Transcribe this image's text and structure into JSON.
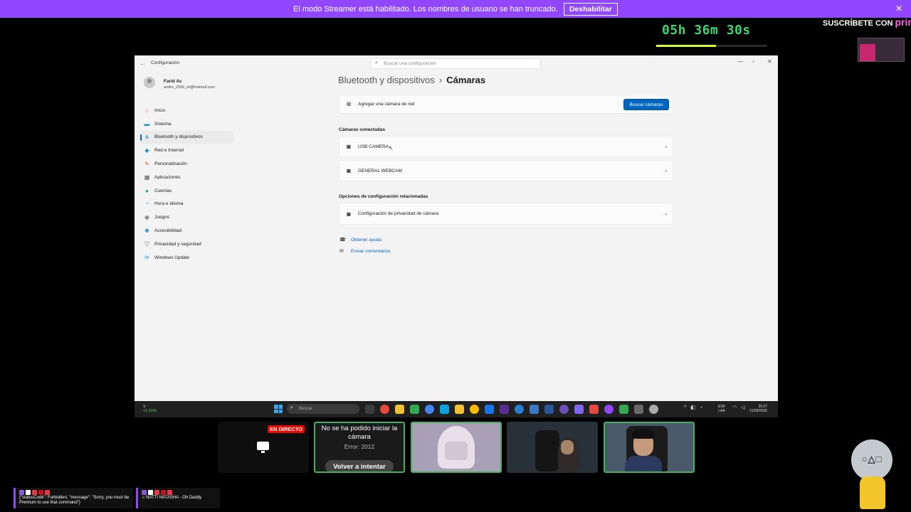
{
  "banner": {
    "text": "El modo Streamer está habilitado. Los nombres de usuario se han truncado.",
    "button": "Deshabilitar",
    "close": "✕"
  },
  "timer": {
    "text": "05h 36m 30s",
    "progress": 0.54
  },
  "prime": {
    "prefix": "SUSCRÍBETE CON",
    "brand": "prime"
  },
  "settings": {
    "app_title": "Configuración",
    "search_placeholder": "Buscar una configuración",
    "user": {
      "name": "Farid Ac",
      "email": "andre_2006_el@hotmail.com"
    },
    "nav": [
      {
        "label": "Inicio",
        "icon": "home-icon",
        "glyph": "⌂",
        "color": "#d9822b"
      },
      {
        "label": "Sistema",
        "icon": "system-icon",
        "glyph": "▬",
        "color": "#1b8fd6"
      },
      {
        "label": "Bluetooth y dispositivos",
        "icon": "bluetooth-icon",
        "glyph": "ʙ",
        "color": "#1b8fd6",
        "active": true
      },
      {
        "label": "Red e Internet",
        "icon": "network-icon",
        "glyph": "◆",
        "color": "#1b8fd6"
      },
      {
        "label": "Personalización",
        "icon": "brush-icon",
        "glyph": "✎",
        "color": "#c25b28"
      },
      {
        "label": "Aplicaciones",
        "icon": "apps-icon",
        "glyph": "▦",
        "color": "#555555"
      },
      {
        "label": "Cuentas",
        "icon": "accounts-icon",
        "glyph": "●",
        "color": "#2aa36b"
      },
      {
        "label": "Hora e idioma",
        "icon": "clock-globe-icon",
        "glyph": "◔",
        "color": "#1b8fd6"
      },
      {
        "label": "Juegos",
        "icon": "gamepad-icon",
        "glyph": "◉",
        "color": "#777777"
      },
      {
        "label": "Accesibilidad",
        "icon": "accessibility-icon",
        "glyph": "✱",
        "color": "#1b8fd6"
      },
      {
        "label": "Privacidad y seguridad",
        "icon": "shield-icon",
        "glyph": "⛉",
        "color": "#666666"
      },
      {
        "label": "Windows Update",
        "icon": "windows-update-icon",
        "glyph": "⟳",
        "color": "#1b8fd6"
      }
    ],
    "breadcrumb": {
      "parent": "Bluetooth y dispositivos",
      "separator": "›",
      "current": "Cámaras"
    },
    "add_camera": {
      "label": "Agregar una cámara de red",
      "button": "Buscar cámaras"
    },
    "connected_title": "Cámaras conectadas",
    "cameras": [
      "USB CAMERA",
      "GENERAL WEBCAM"
    ],
    "related_title": "Opciones de configuración relacionadas",
    "privacy_label": "Configuración de privacidad de cámara",
    "links": {
      "help": "Obtener ayuda",
      "feedback": "Enviar comentarios"
    }
  },
  "taskbar": {
    "weather_temp": "+1.21%",
    "weather_top": "V",
    "search_placeholder": "Buscar",
    "lang_top": "ESP",
    "lang_bottom": "LAA",
    "time": "20:27",
    "date": "21/09/2025",
    "icon_colors": [
      "#3d3d3d",
      "#e6483d",
      "#f2c131",
      "#34a853",
      "#4285f4",
      "#0aa1e3",
      "#f2c131",
      "#ffb900",
      "#1a73e8",
      "#5c2d91",
      "#2b7cd3",
      "#3a78c3",
      "#2b579a",
      "#6b4fbb",
      "#7b68ee",
      "#e6483d",
      "#9147ff",
      "#34a853",
      "#6a6a6a",
      "#aaaaaa"
    ]
  },
  "tiles": {
    "live_badge": "EN DIRECTO",
    "error_title": "No se ha podido iniciar la cámara",
    "error_code": "Error: 2012",
    "retry": "Volver a intentar"
  },
  "chat": {
    "left_text": "{\"statusCode\": Forbidden, \"message\": \"Sorry, you must be Premium to use that command\"}",
    "right_text": "♫ NATTI NATASHA - Oh Daddy"
  },
  "mascot": {
    "shapes": "○△□"
  },
  "colors": {
    "accent": "#0067c0",
    "banner": "#9147ff",
    "timer": "#3cd673",
    "tile_border": "#46b060"
  }
}
